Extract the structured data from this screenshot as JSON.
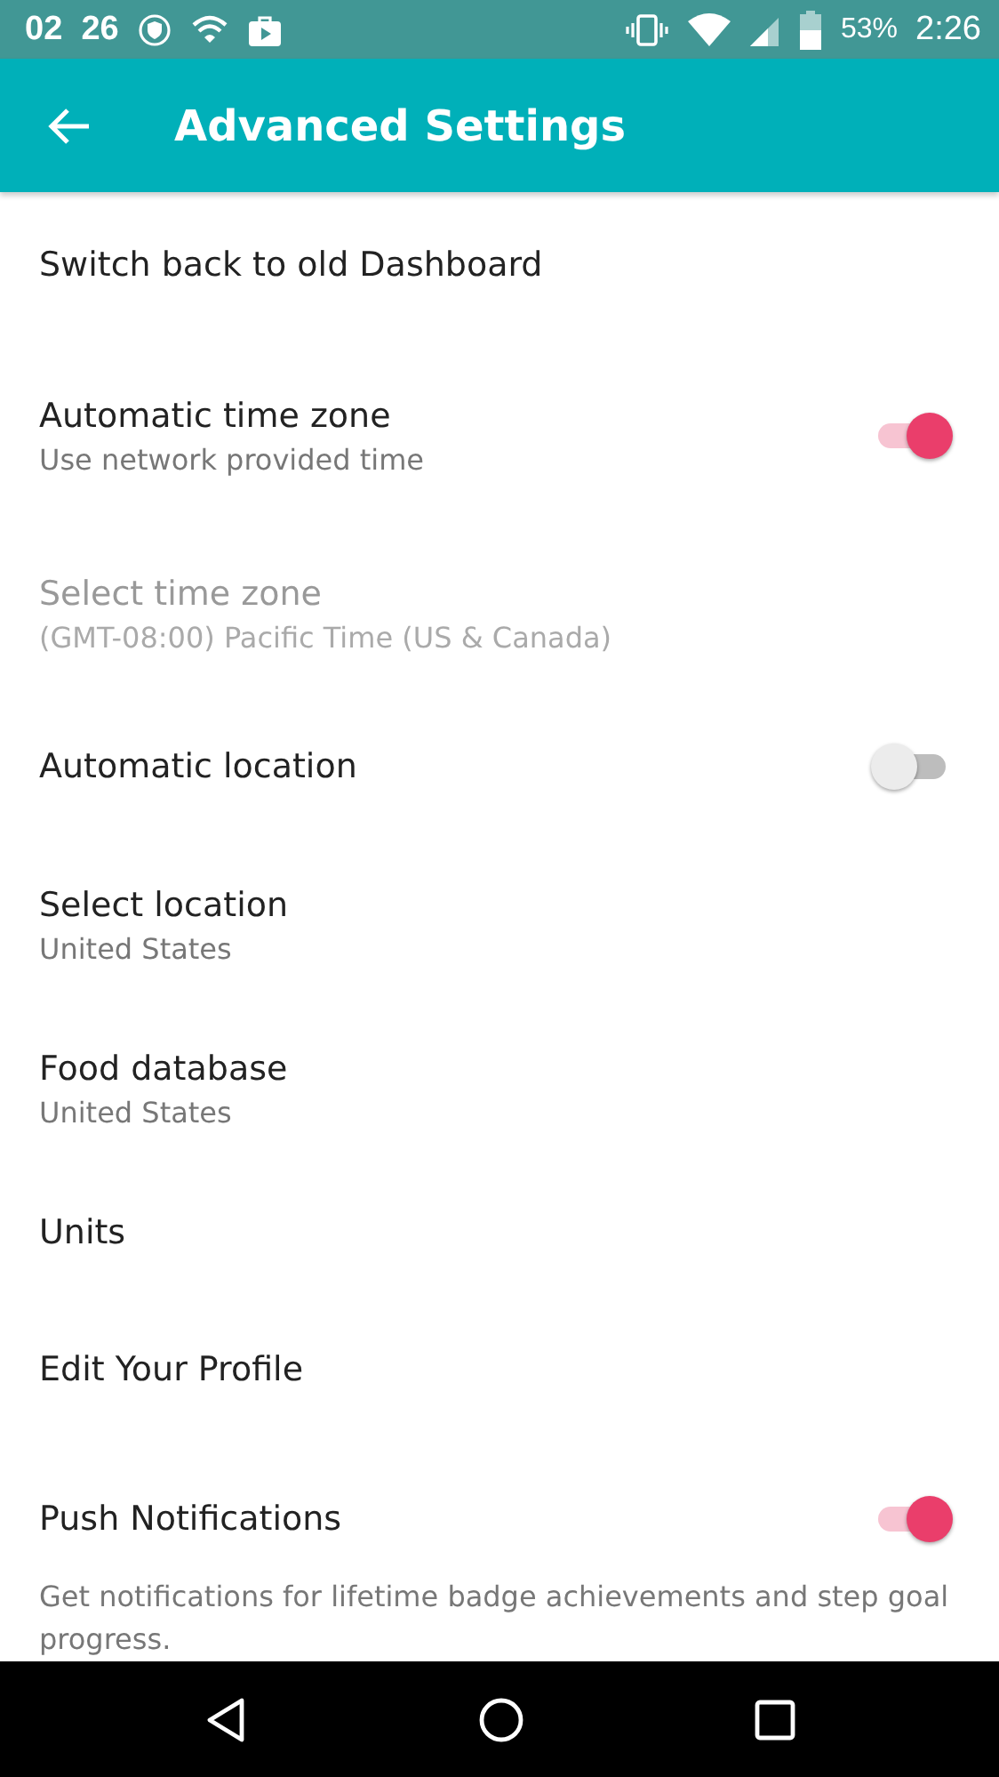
{
  "status_bar": {
    "left_time": "02  26",
    "battery": "53%",
    "time": "2:26"
  },
  "app_bar": {
    "title": "Advanced Settings"
  },
  "settings": [
    {
      "kind": "plain",
      "title": "Switch back to old Dashboard",
      "disabled": false
    },
    {
      "kind": "toggle",
      "title": "Automatic time zone",
      "subtitle": "Use network provided time",
      "on": true,
      "disabled": false
    },
    {
      "kind": "plain",
      "title": "Select time zone",
      "subtitle": "(GMT-08:00) Pacific Time (US & Canada)",
      "disabled": true
    },
    {
      "kind": "toggle",
      "title": "Automatic location",
      "on": false,
      "disabled": false
    },
    {
      "kind": "plain",
      "title": "Select location",
      "subtitle": "United States",
      "disabled": false
    },
    {
      "kind": "plain",
      "title": "Food database",
      "subtitle": "United States",
      "disabled": false
    },
    {
      "kind": "plain",
      "title": "Units",
      "disabled": false
    },
    {
      "kind": "plain",
      "title": "Edit Your Profile",
      "disabled": false
    },
    {
      "kind": "toggle",
      "title": "Push Notifications",
      "on": true,
      "disabled": false,
      "description": "Get notifications for lifetime badge achievements and step goal progress."
    }
  ]
}
